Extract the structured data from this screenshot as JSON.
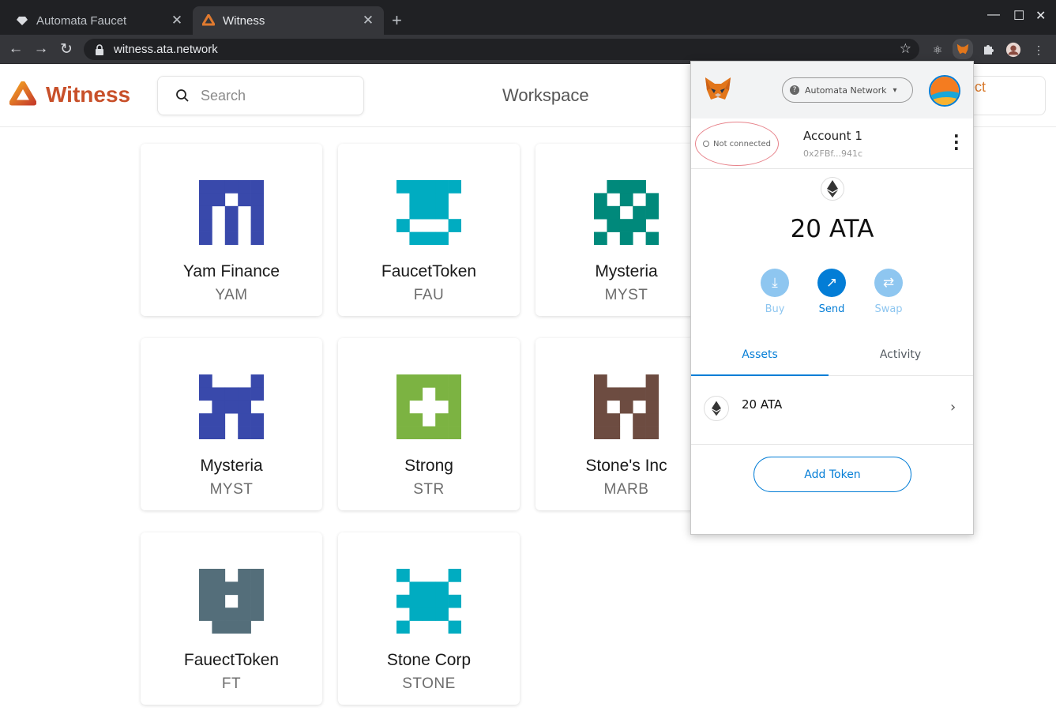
{
  "browser": {
    "tabs": [
      {
        "title": "Automata Faucet",
        "active": false
      },
      {
        "title": "Witness",
        "active": true
      }
    ],
    "url": "witness.ata.network"
  },
  "header": {
    "brand": "Witness",
    "search_placeholder": "Search",
    "workspace": "Workspace",
    "connect_wallet": "Connect wallet"
  },
  "tokens": [
    {
      "name": "Yam Finance",
      "symbol": "YAM",
      "color": "#3949ab"
    },
    {
      "name": "FaucetToken",
      "symbol": "FAU",
      "color": "#00acc1"
    },
    {
      "name": "Mysteria",
      "symbol": "MYST",
      "color": "#00897b"
    },
    {
      "name": "Mysteria",
      "symbol": "MYST",
      "color": "#3949ab"
    },
    {
      "name": "Strong",
      "symbol": "STR",
      "color": "#7cb342"
    },
    {
      "name": "Stone's Inc",
      "symbol": "MARB",
      "color": "#6d4c41"
    },
    {
      "name": "FauectToken",
      "symbol": "FT",
      "color": "#546e7a"
    },
    {
      "name": "Stone Corp",
      "symbol": "STONE",
      "color": "#00acc1"
    }
  ],
  "metamask": {
    "network": "Automata Network",
    "status": "Not connected",
    "account_name": "Account 1",
    "account_address": "0x2FBf...941c",
    "balance": "20 ATA",
    "actions": [
      "Buy",
      "Send",
      "Swap"
    ],
    "tabs": [
      "Assets",
      "Activity"
    ],
    "asset_label": "20 ATA",
    "add_token": "Add Token"
  }
}
